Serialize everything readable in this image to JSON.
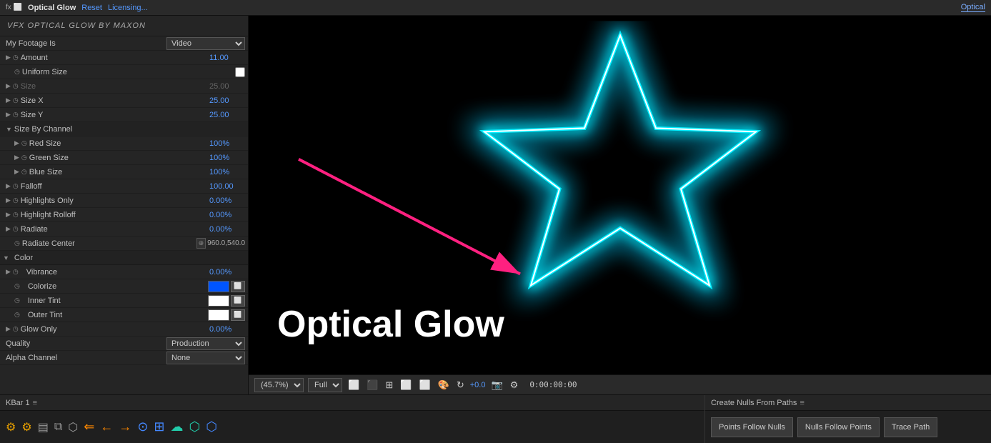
{
  "topbar": {
    "title": "Optical Glow",
    "reset_label": "Reset",
    "licensing_label": "Licensing...",
    "tab_label": "Optical"
  },
  "plugin_header": "VFX OPTICAL GLOW BY MAXON",
  "properties": {
    "my_footage_is_label": "My Footage Is",
    "my_footage_is_value": "Video",
    "amount_label": "Amount",
    "amount_value": "11.00",
    "uniform_size_label": "Uniform Size",
    "size_label": "Size",
    "size_value": "25.00",
    "size_x_label": "Size X",
    "size_x_value": "25.00",
    "size_y_label": "Size Y",
    "size_y_value": "25.00",
    "size_by_channel_label": "Size By Channel",
    "red_size_label": "Red Size",
    "red_size_value": "100",
    "green_size_label": "Green Size",
    "green_size_value": "100",
    "blue_size_label": "Blue Size",
    "blue_size_value": "100",
    "falloff_label": "Falloff",
    "falloff_value": "100.00",
    "highlights_only_label": "Highlights Only",
    "highlights_only_value": "0.00",
    "highlight_rolloff_label": "Highlight Rolloff",
    "highlight_rolloff_value": "0.00",
    "radiate_label": "Radiate",
    "radiate_value": "0.00",
    "radiate_center_label": "Radiate Center",
    "radiate_center_value": "960.0,540.0",
    "color_label": "Color",
    "vibrance_label": "Vibrance",
    "vibrance_value": "0.00",
    "colorize_label": "Colorize",
    "inner_tint_label": "Inner Tint",
    "outer_tint_label": "Outer Tint",
    "glow_only_label": "Glow Only",
    "glow_only_value": "0.00",
    "quality_label": "Quality",
    "quality_value": "Production",
    "alpha_channel_label": "Alpha Channel",
    "alpha_channel_value": "None"
  },
  "preview": {
    "zoom_label": "(45.7%)",
    "quality_label": "Full",
    "timecode": "0:00:00:00",
    "plus_value": "+0.0",
    "optical_glow_text": "Optical Glow"
  },
  "bottom": {
    "kbar_label": "KBar 1",
    "create_nulls_label": "Create Nulls From Paths",
    "points_follow_nulls_label": "Points Follow Nulls",
    "nulls_follow_points_label": "Nulls Follow Points",
    "trace_path_label": "Trace Path"
  }
}
